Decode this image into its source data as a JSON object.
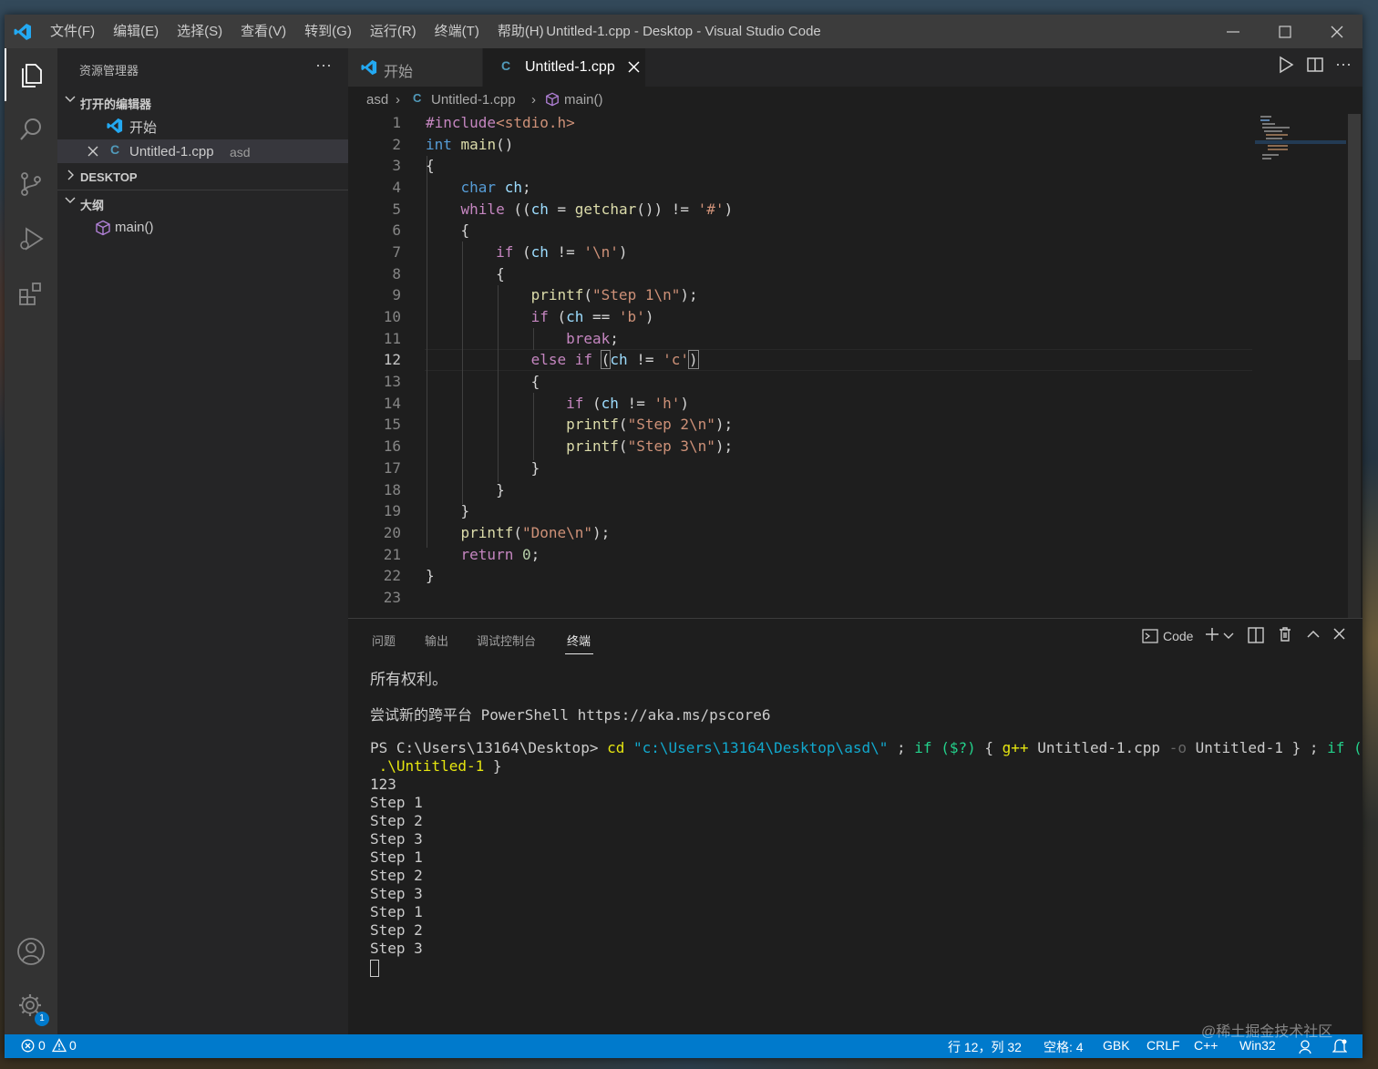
{
  "window": {
    "title": "Untitled-1.cpp - Desktop - Visual Studio Code",
    "menu": [
      "文件(F)",
      "编辑(E)",
      "选择(S)",
      "查看(V)",
      "转到(G)",
      "运行(R)",
      "终端(T)",
      "帮助(H)"
    ]
  },
  "sidebar": {
    "title": "资源管理器",
    "more": "···",
    "open_editors_label": "打开的编辑器",
    "open_editors": [
      {
        "name": "开始",
        "dir": ""
      },
      {
        "name": "Untitled-1.cpp",
        "dir": "asd"
      }
    ],
    "desktop_label": "DESKTOP",
    "outline_label": "大纲",
    "outline_items": [
      "main()"
    ]
  },
  "tabs": [
    {
      "label": "开始",
      "active": false
    },
    {
      "label": "Untitled-1.cpp",
      "active": true
    }
  ],
  "breadcrumb": {
    "folder": "asd",
    "file": "Untitled-1.cpp",
    "symbol": "main()"
  },
  "code": {
    "current_line": 12,
    "line_numbers": [
      "1",
      "2",
      "3",
      "4",
      "5",
      "6",
      "7",
      "8",
      "9",
      "10",
      "11",
      "12",
      "13",
      "14",
      "15",
      "16",
      "17",
      "18",
      "19",
      "20",
      "21",
      "22",
      "23"
    ]
  },
  "panel": {
    "tabs": [
      "问题",
      "输出",
      "调试控制台",
      "终端"
    ],
    "active_tab": "终端",
    "shell_label": "Code"
  },
  "terminal": {
    "copyright": "所有权利。",
    "try_line": "尝试新的跨平台 PowerShell https://aka.ms/pscore6",
    "prompt": "PS C:\\Users\\13164\\Desktop>",
    "cmd_cd": "cd",
    "cmd_path": "\"c:\\Users\\13164\\Desktop\\asd\\\"",
    "cmd_sep1": ";",
    "cmd_if1": "if",
    "cmd_cond1": "($?)",
    "cmd_brace1": "{",
    "cmd_gpp": "g++",
    "cmd_src": "Untitled-1.cpp",
    "cmd_o": "-o",
    "cmd_out": "Untitled-1",
    "cmd_brace_close1": "}",
    "cmd_sep2": ";",
    "cmd_if2": "if",
    "cmd_cond2": "($?)",
    "cmd_brace2": "{",
    "cmd_run": ".\\Untitled-1",
    "cmd_brace_close2": "}",
    "input": "123",
    "output": [
      "Step 1",
      "Step 2",
      "Step 3",
      "Step 1",
      "Step 2",
      "Step 3",
      "Step 1",
      "Step 2",
      "Step 3"
    ]
  },
  "status": {
    "errors": "0",
    "warnings": "0",
    "position": "行 12，列 32",
    "spaces": "空格: 4",
    "encoding": "GBK",
    "eol": "CRLF",
    "language": "C++",
    "platform": "Win32",
    "settings_badge": "1"
  },
  "watermark": "@稀土掘金技术社区",
  "colors": {
    "accent": "#007acc",
    "keyword": "#569cd6",
    "control": "#c586c0",
    "function": "#dcdcaa",
    "string": "#ce9178",
    "variable": "#9cdcfe"
  }
}
